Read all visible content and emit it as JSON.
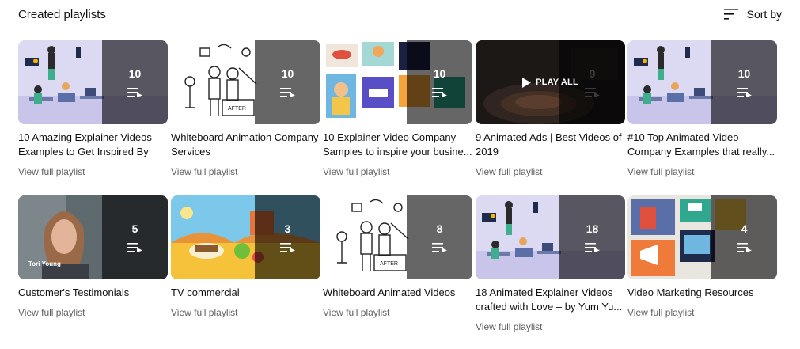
{
  "header": {
    "title": "Created playlists",
    "sort_label": "Sort by"
  },
  "playlists": [
    {
      "title": "10 Amazing Explainer Videos Examples to Get Inspired By",
      "count": "10",
      "link": "View full playlist",
      "thumb": "office-illustration"
    },
    {
      "title": "Whiteboard Animation Company Services",
      "count": "10",
      "link": "View full playlist",
      "thumb": "whiteboard-sketch"
    },
    {
      "title": "10 Explainer Video Company Samples to inspire your busine...",
      "count": "10",
      "link": "View full playlist",
      "thumb": "collage-illustration"
    },
    {
      "title": "9 Animated Ads | Best Videos of 2019",
      "count": "9",
      "link": "View full playlist",
      "thumb": "dark-plate",
      "hover_label": "PLAY ALL"
    },
    {
      "title": "#10 Top Animated Video Company Examples that really...",
      "count": "10",
      "link": "View full playlist",
      "thumb": "office-illustration"
    },
    {
      "title": "Customer's Testimonials",
      "count": "5",
      "link": "View full playlist",
      "thumb": "woman-portrait",
      "caption_name": "Tori Young"
    },
    {
      "title": "TV commercial",
      "count": "3",
      "link": "View full playlist",
      "thumb": "cartoon-food"
    },
    {
      "title": "Whiteboard Animated Videos",
      "count": "8",
      "link": "View full playlist",
      "thumb": "whiteboard-sketch"
    },
    {
      "title": "18 Animated Explainer Videos crafted with Love – by Yum Yu...",
      "count": "18",
      "link": "View full playlist",
      "thumb": "office-illustration"
    },
    {
      "title": "Video Marketing Resources",
      "count": "4",
      "link": "View full playlist",
      "thumb": "marketing-icons"
    }
  ]
}
